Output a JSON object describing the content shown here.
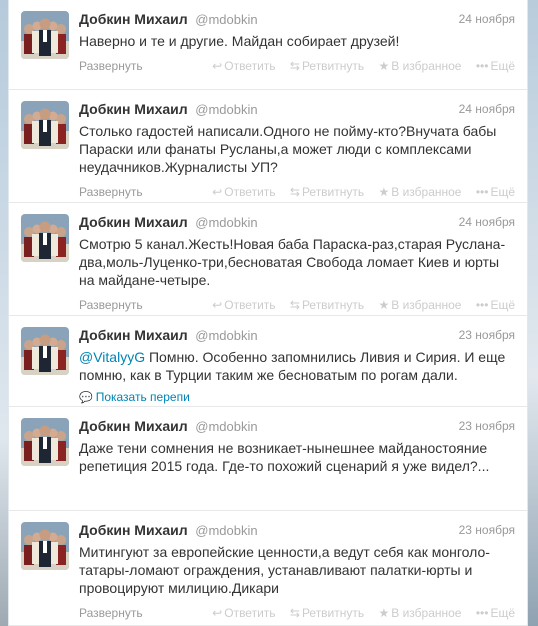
{
  "actions": {
    "reply": "Ответить",
    "retweet": "Ретвитнуть",
    "favorite": "В избранное",
    "more": "Ещё",
    "reply_icon": "reply-arrow-icon",
    "retweet_icon": "retweet-icon",
    "favorite_icon": "star-icon",
    "more_icon": "dots-icon"
  },
  "tweets": [
    {
      "name": "Добкин Михаил",
      "username": "@mdobkin",
      "time": "24 ноября",
      "mention": "",
      "text": "Наверно и те и другие. Майдан собирает друзей!",
      "expand": "Развернуть"
    },
    {
      "name": "Добкин Михаил",
      "username": "@mdobkin",
      "time": "24 ноября",
      "mention": "",
      "text": "Столько гадостей написали.Одного не пойму-кто?Внучата бабы Параски или фанаты Русланы,а может люди с комплексами неудачников.Журналисты УП?",
      "expand": "Развернуть"
    },
    {
      "name": "Добкин Михаил",
      "username": "@mdobkin",
      "time": "24 ноября",
      "mention": "",
      "text": "Смотрю 5 канал.Жесть!Новая баба Параска-раз,старая Руслана-два,моль-Луценко-три,бесноватая Свобода ломает Киев и юрты на майдане-четыре.",
      "expand": "Развернуть"
    },
    {
      "name": "Добкин Михаил",
      "username": "@mdobkin",
      "time": "23 ноября",
      "mention": "@VitalyyG",
      "text": " Помню. Особенно запомнились Ливия и Сирия. И еще помню, как в Турции таким же бесноватым по рогам дали.",
      "expand": "Показать перепи"
    },
    {
      "name": "Добкин Михаил",
      "username": "@mdobkin",
      "time": "23 ноября",
      "mention": "",
      "text": "Даже тени сомнения не возникает-нынешнее майданостояние репетиция 2015 года. Где-то похожий сценарий я уже видел?...",
      "expand": ""
    },
    {
      "name": "Добкин Михаил",
      "username": "@mdobkin",
      "time": "23 ноября",
      "mention": "",
      "text": "Митингуют за европейские ценности,а ведут себя как монголо-татары-ломают ограждения, устанавливают палатки-юрты и провоцируют милицию.Дикари",
      "expand": "Развернуть"
    }
  ]
}
